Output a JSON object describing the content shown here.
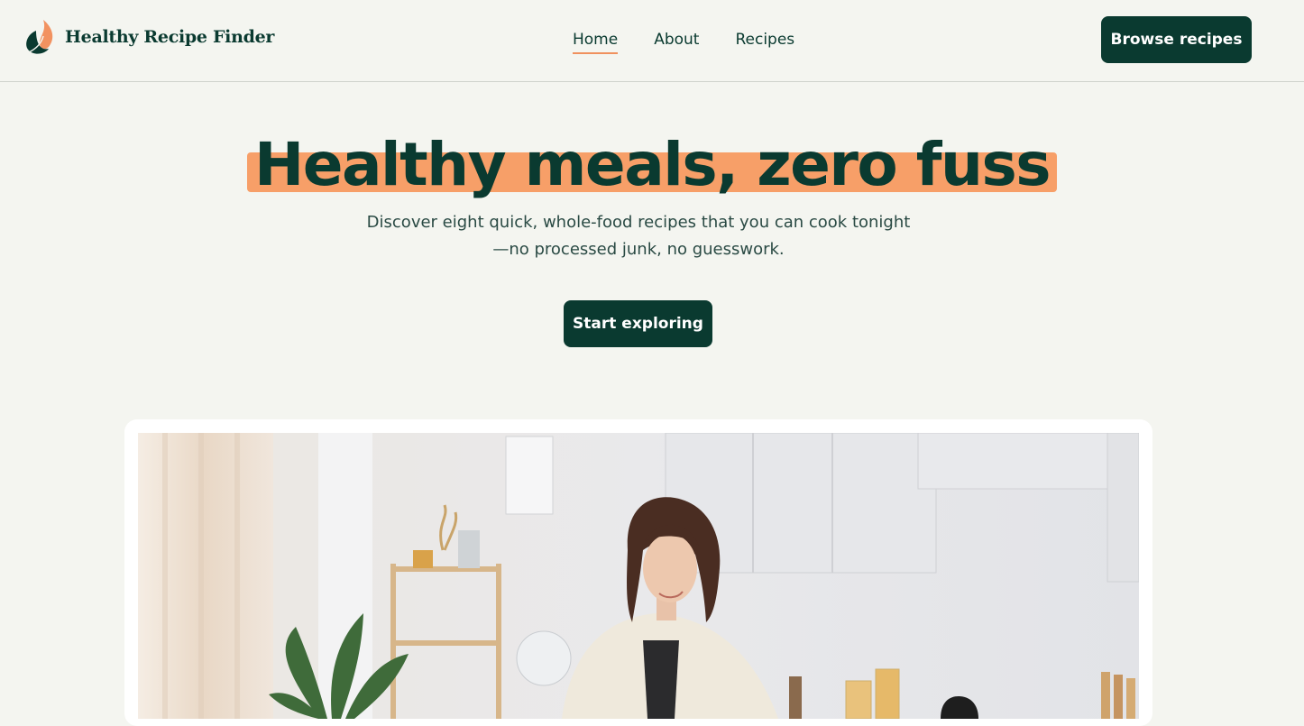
{
  "header": {
    "brand_name": "Healthy Recipe Finder",
    "nav": [
      {
        "label": "Home",
        "active": true
      },
      {
        "label": "About",
        "active": false
      },
      {
        "label": "Recipes",
        "active": false
      }
    ],
    "cta_label": "Browse recipes"
  },
  "hero": {
    "title": "Healthy meals, zero fuss",
    "subtitle_line1": "Discover eight quick, whole-food recipes that you can cook tonight",
    "subtitle_line2": "—no processed junk, no guesswork.",
    "button_label": "Start exploring"
  },
  "colors": {
    "primary": "#0a3a30",
    "accent": "#f79f68",
    "background": "#f4f5f0"
  },
  "icons": {
    "logo": "leaf-flame-logo-icon"
  }
}
